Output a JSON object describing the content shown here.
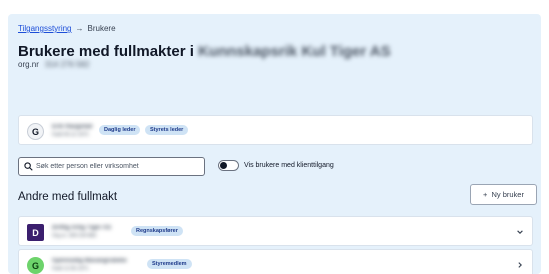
{
  "breadcrumb": {
    "parent": "Tilgangsstyring",
    "arrow": "→",
    "current": "Brukere"
  },
  "page": {
    "title_prefix": "Brukere med fullmakter i",
    "company": "Kunnskapsrik Kul Tiger AS",
    "org_label": "org.nr",
    "org_number": "314 276 582"
  },
  "current_user": {
    "initial": "G",
    "name": "Erik Haugstad",
    "sub": "Født 09.12.1972",
    "roles": [
      "Daglig leder",
      "Styrets leder"
    ]
  },
  "search": {
    "placeholder": "Søk etter person eller virksomhet",
    "value": ""
  },
  "toggle": {
    "label": "Vis brukere med klienttilgang",
    "on": false
  },
  "others": {
    "title": "Andre med fullmakt",
    "new_button": "Ny bruker",
    "items": [
      {
        "initial": "D",
        "name": "Driftig Artig Tiger AS",
        "sub": "Org.nr. 309 234 882",
        "role": "Regnskapsfører",
        "expanded": true,
        "avatar_color": "#3b1f6e"
      },
      {
        "initial": "G",
        "name": "Gjennsidig Mavangrubeke",
        "sub": "Født 12.05.1971",
        "role": "Styremedlem",
        "expanded": false,
        "avatar_color": "#6dd36b"
      }
    ]
  },
  "colors": {
    "panel_bg": "#e5f1fb",
    "badge_bg": "#cfe3f5",
    "link": "#1d4ed8"
  }
}
